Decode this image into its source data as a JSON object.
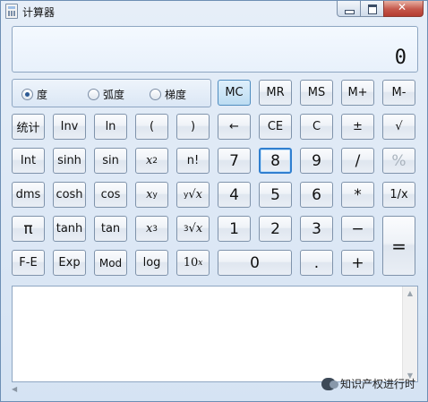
{
  "window": {
    "title": "计算器"
  },
  "display": {
    "value": "0"
  },
  "angle_modes": [
    {
      "label": "度",
      "selected": true
    },
    {
      "label": "弧度",
      "selected": false
    },
    {
      "label": "梯度",
      "selected": false
    }
  ],
  "memory": [
    "MC",
    "MR",
    "MS",
    "M+",
    "M-"
  ],
  "buttons": {
    "stat": "统计",
    "inv": "Inv",
    "ln": "ln",
    "lparen": "(",
    "rparen": ")",
    "back": "←",
    "ce": "CE",
    "c": "C",
    "neg": "±",
    "sqrt": "√",
    "int": "Int",
    "sinh": "sinh",
    "sin": "sin",
    "x2_base": "x",
    "x2_exp": "2",
    "fact": "n!",
    "d7": "7",
    "d8": "8",
    "d9": "9",
    "div": "/",
    "pct": "%",
    "dms": "dms",
    "cosh": "cosh",
    "cos": "cos",
    "xy_base": "x",
    "xy_exp": "y",
    "yroot_idx": "y",
    "yroot_rad": "√",
    "yroot_x": "x",
    "d4": "4",
    "d5": "5",
    "d6": "6",
    "mul": "*",
    "recip": "1/x",
    "pi": "π",
    "tanh": "tanh",
    "tan": "tan",
    "x3_base": "x",
    "x3_exp": "3",
    "croot_idx": "3",
    "croot_rad": "√",
    "croot_x": "x",
    "d1": "1",
    "d2": "2",
    "d3": "3",
    "sub": "−",
    "eq": "=",
    "fe": "F-E",
    "exp": "Exp",
    "mod": "Mod",
    "log": "log",
    "tenx_base": "10",
    "tenx_exp": "x",
    "d0": "0",
    "dot": ".",
    "add": "+"
  },
  "watermark": "知识产权进行时"
}
